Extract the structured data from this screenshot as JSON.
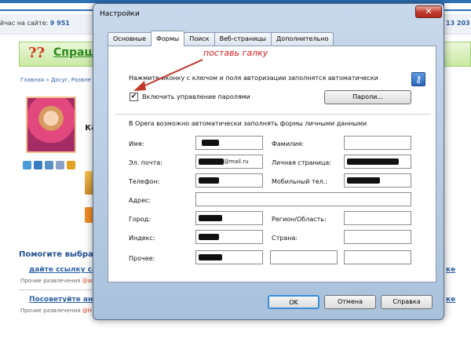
{
  "background": {
    "online_label": "йчас на сайте:",
    "online_count": "9 951",
    "right_count": "13 203",
    "logo_mark": "??",
    "brand": "Спраш",
    "breadcrumbs": "Главная » Досуг, Развле",
    "question_start": "ка",
    "help_title": "Помогите выбрать",
    "links": [
      {
        "title": "дайте ссылку сайт",
        "sub": "Прочие развлечения",
        "author": "@ап"
      },
      {
        "title": "Посоветуйте аним",
        "sub": "Прочие развлечения",
        "author": "@Н"
      }
    ],
    "right_fragments": [
      "ке",
      "ке"
    ]
  },
  "dialog": {
    "title": "Настройки",
    "close_glyph": "✕",
    "tabs": [
      {
        "label": "Основные",
        "active": false
      },
      {
        "label": "Формы",
        "active": true
      },
      {
        "label": "Поиск",
        "active": false
      },
      {
        "label": "Веб-страницы",
        "active": false
      },
      {
        "label": "Дополнительно",
        "active": false
      }
    ],
    "wand_hint": "Нажмите иконку с ключом и поля авторизации заполнятся автоматически",
    "key_icon": "key-icon",
    "password_checkbox": {
      "label": "Включить управление паролями",
      "checked": true,
      "check_glyph": "✔"
    },
    "passwords_button": "Пароли...",
    "autofill_hint": "В Opera возможно автоматически заполнять формы личными данными",
    "fields": {
      "name": {
        "label": "Имя:",
        "value": ""
      },
      "surname": {
        "label": "Фамилия:",
        "value": ""
      },
      "email": {
        "label": "Эл. почта:",
        "value": "@mail.ru"
      },
      "homepage": {
        "label": "Личная страница:",
        "value": ""
      },
      "phone": {
        "label": "Телефон:",
        "value": ""
      },
      "mobile": {
        "label": "Мобильный тел.:",
        "value": ""
      },
      "address": {
        "label": "Адрес:",
        "value": ""
      },
      "city": {
        "label": "Город:",
        "value": ""
      },
      "region": {
        "label": "Регион/Область:",
        "value": ""
      },
      "zip": {
        "label": "Индекс:",
        "value": ""
      },
      "country": {
        "label": "Страна:",
        "value": ""
      },
      "other": {
        "label": "Прочее:",
        "value": ""
      }
    },
    "buttons": {
      "ok": "OK",
      "cancel": "Отмена",
      "help": "Справка"
    }
  },
  "annotation": {
    "text": "поставь галку",
    "color": "#d41c1c"
  }
}
